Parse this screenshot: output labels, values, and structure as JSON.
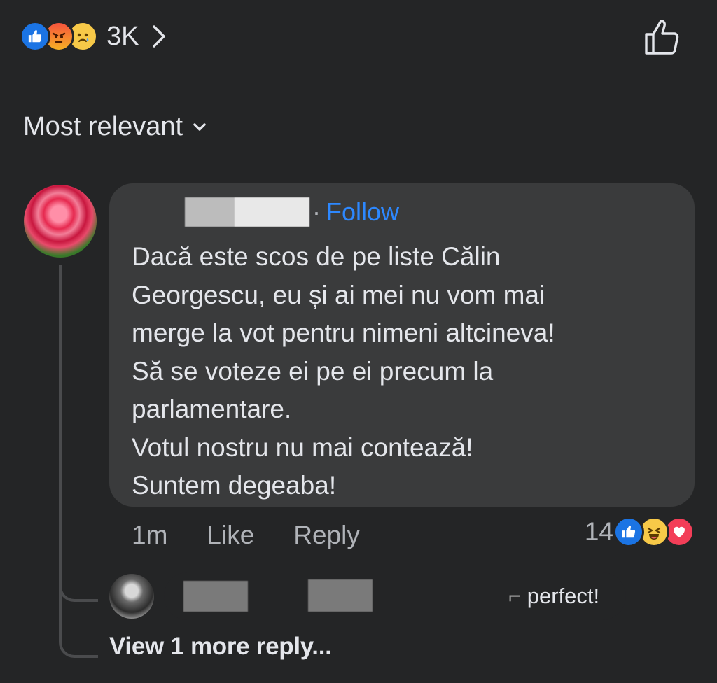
{
  "header": {
    "reaction_icons": [
      "like-icon",
      "angry-icon",
      "sad-icon"
    ],
    "reaction_count": "3K",
    "like_icon": "thumbs-up-outline-icon"
  },
  "sort": {
    "label": "Most relevant"
  },
  "comment": {
    "follow_label": "Follow",
    "text_lines": [
      "Dacă este scos de pe liste Călin",
      "Georgescu,  eu și ai mei nu vom mai",
      "merge la vot pentru nimeni altcineva!",
      "Să se voteze ei pe ei precum la",
      "parlamentare.",
      "Votul nostru nu mai contează!",
      "Suntem degeaba!"
    ],
    "time": "1m",
    "like_label": "Like",
    "reply_label": "Reply",
    "reaction_count": "14",
    "reaction_icons": [
      "like-icon",
      "haha-icon",
      "love-icon"
    ]
  },
  "reply": {
    "snippet": "perfect!",
    "view_more": "View 1 more reply..."
  },
  "colors": {
    "background": "#242526",
    "bubble": "#3a3b3c",
    "link": "#2d88ff",
    "like_blue": "#1b74e4",
    "love_red": "#f33e58"
  }
}
